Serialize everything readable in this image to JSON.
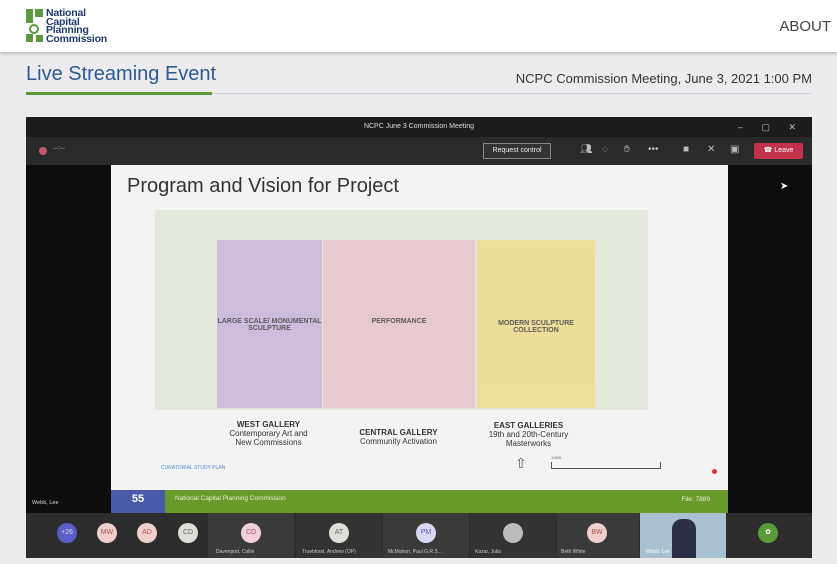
{
  "header": {
    "logo_lines": [
      "National",
      "Capital",
      "Planning",
      "Commission"
    ],
    "about": "ABOUT"
  },
  "page": {
    "title": "Live Streaming Event",
    "meeting": "NCPC Commission Meeting, June 3, 2021 1:00 PM"
  },
  "teams": {
    "window_title": "NCPC June 3 Commission Meeting",
    "window_controls": "– ▢ ✕",
    "request_control": "Request control",
    "leave": "Leave",
    "leave_color": "#c4314b",
    "slide": {
      "title": "Program and Vision for Project",
      "zones": [
        "LARGE SCALE/ MONUMENTAL SCULPTURE",
        "PERFORMANCE",
        "MODERN SCULPTURE COLLECTION"
      ],
      "galleries": [
        {
          "name": "WEST GALLERY",
          "desc": "Contemporary Art and New Commissions"
        },
        {
          "name": "CENTRAL GALLERY",
          "desc": "Community Activation"
        },
        {
          "name": "EAST GALLERIES",
          "desc": "19th and 20th-Century Masterworks"
        }
      ],
      "caption": "CURATORIAL STUDY PLAN",
      "scale": "1:500",
      "page_number": "55",
      "org": "National Capital Planning Commission",
      "file": "File: 7889"
    },
    "speaker": "Webb, Lee",
    "participants": [
      {
        "initials": "+26"
      },
      {
        "initials": "MW"
      },
      {
        "initials": "AD"
      },
      {
        "initials": "CD"
      }
    ],
    "tiles": [
      {
        "initials": "CD",
        "name": "Davenport, Collin"
      },
      {
        "initials": "AT",
        "name": "Trueblood, Andrew (OP)"
      },
      {
        "initials": "PM",
        "name": "McMahon, Paul G.R.S..."
      },
      {
        "initials": "",
        "name": "Kozar, Julia"
      },
      {
        "initials": "BW",
        "name": "Beth White"
      },
      {
        "initials": "",
        "name": "Webb, Lee"
      }
    ]
  }
}
